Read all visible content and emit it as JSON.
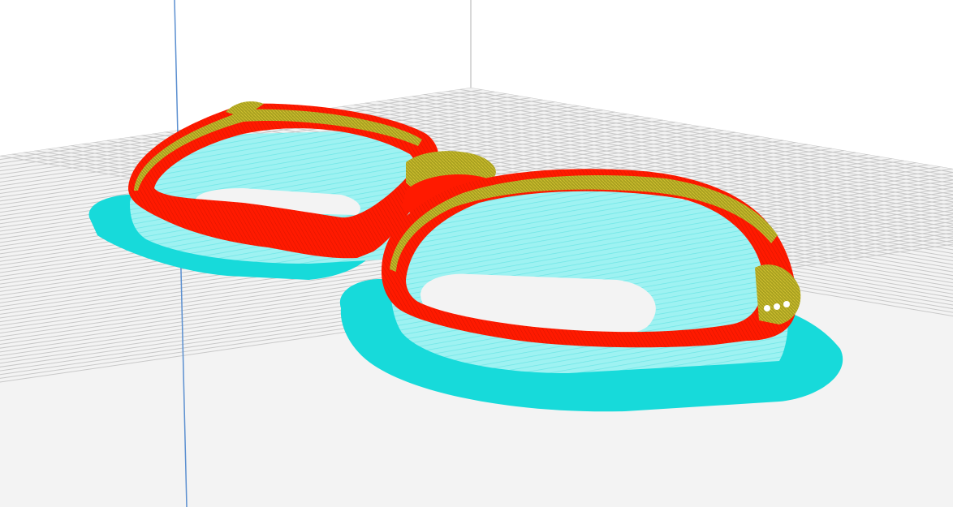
{
  "viewport": {
    "background": "#ffffff",
    "build_plate_color": "#f3f3f3",
    "grid_color": "#c8c8c8",
    "axis_line_color": "#5b8fd0"
  },
  "model": {
    "name_visible": false,
    "object": "eyeglasses-frame",
    "colors": {
      "wall_outer": "#ff1a00",
      "wall_inner": "#9aa21c",
      "support": "#8ff0f0",
      "support_dense": "#20e0e0",
      "skirt": "#15dede"
    }
  }
}
